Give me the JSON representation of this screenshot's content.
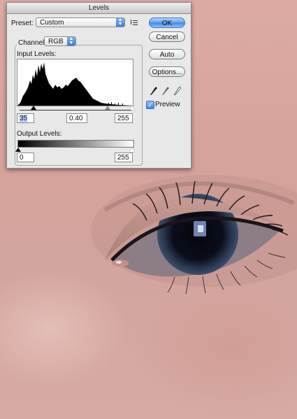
{
  "dialog": {
    "title": "Levels",
    "preset_label": "Preset:",
    "preset_value": "Custom",
    "channel_label": "Channel:",
    "channel_value": "RGB",
    "input_levels_label": "Input Levels:",
    "input_black": "35",
    "input_gamma": "0.40",
    "input_white": "255",
    "output_levels_label": "Output Levels:",
    "output_black": "0",
    "output_white": "255",
    "buttons": {
      "ok": "OK",
      "cancel": "Cancel",
      "auto": "Auto",
      "options": "Options..."
    },
    "preview_label": "Preview",
    "preview_checked": true
  },
  "icons": {
    "preset_menu": "preset-options-icon",
    "droppers": [
      "black-eyedropper-icon",
      "gray-eyedropper-icon",
      "white-eyedropper-icon"
    ]
  },
  "colors": {
    "accent": "#3f86ea",
    "skin": "#d6a39b",
    "iris": "#0a0d1a"
  }
}
